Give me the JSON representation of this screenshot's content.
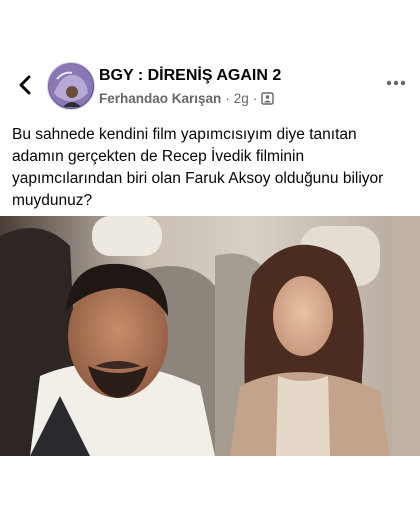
{
  "post": {
    "group_name": "BGY : DİRENİŞ AGAIN 2",
    "author": "Ferhandao Karışan",
    "separator": "·",
    "time": "2g",
    "text": "Bu sahnede kendini film yapımcısıyım diye tanıtan adamın gerçekten de Recep İvedik filminin yapımcılarından biri olan Faruk Aksoy olduğunu biliyor muydunuz?"
  },
  "icons": {
    "back": "back-arrow-icon",
    "more": "more-options-icon",
    "audience": "group-members-icon"
  },
  "colors": {
    "secondary_text": "#65676b",
    "primary_text": "#050505"
  }
}
